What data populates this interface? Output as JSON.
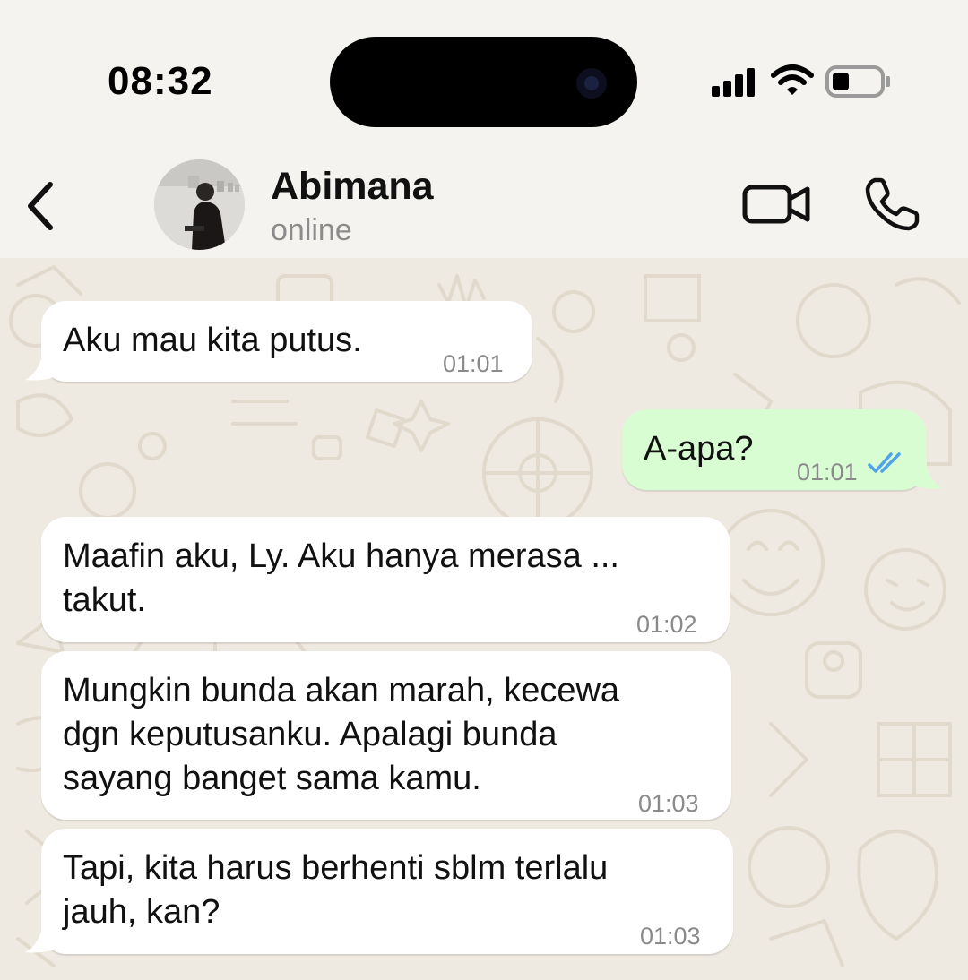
{
  "status_bar": {
    "time": "08:32"
  },
  "header": {
    "contact_name": "Abimana",
    "contact_status": "online"
  },
  "icons": {
    "back": "chevron-left-icon",
    "video": "video-camera-icon",
    "call": "phone-icon",
    "read": "double-check-icon"
  },
  "colors": {
    "incoming_bubble": "#ffffff",
    "outgoing_bubble": "#d9fdd3",
    "read_ticks": "#4fa3e8",
    "wallpaper": "#efeae1"
  },
  "messages": [
    {
      "direction": "in",
      "text": "Aku mau kita putus.",
      "time": "01:01"
    },
    {
      "direction": "out",
      "text": "A-apa?",
      "time": "01:01",
      "status": "read"
    },
    {
      "direction": "in",
      "text": "Maafin aku, Ly. Aku hanya merasa ...\ntakut.",
      "time": "01:02"
    },
    {
      "direction": "in",
      "text": "Mungkin bunda akan marah, kecewa\ndgn keputusanku. Apalagi bunda\nsayang banget sama kamu.",
      "time": "01:03"
    },
    {
      "direction": "in",
      "text": "Tapi, kita harus berhenti sblm terlalu\njauh, kan?",
      "time": "01:03"
    }
  ]
}
